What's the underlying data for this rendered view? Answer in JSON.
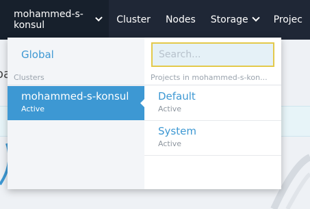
{
  "topnav": {
    "cluster_selector": "mohammed-s-konsul",
    "items": [
      "Cluster",
      "Nodes",
      "Storage",
      "Projec"
    ]
  },
  "dropdown": {
    "global_label": "Global",
    "clusters_header": "Clusters",
    "clusters": [
      {
        "name": "mohammed-s-konsul",
        "status": "Active"
      }
    ],
    "search": {
      "placeholder": "Search...",
      "value": ""
    },
    "projects_header": "Projects in mohammed-s-kon...",
    "projects": [
      {
        "name": "Default",
        "status": "Active"
      },
      {
        "name": "System",
        "status": "Active"
      }
    ]
  },
  "background": {
    "partial_text": "oa"
  },
  "colors": {
    "nav_bg": "#1f2736",
    "accent": "#3d98d3",
    "search_border": "#e3c94a"
  }
}
